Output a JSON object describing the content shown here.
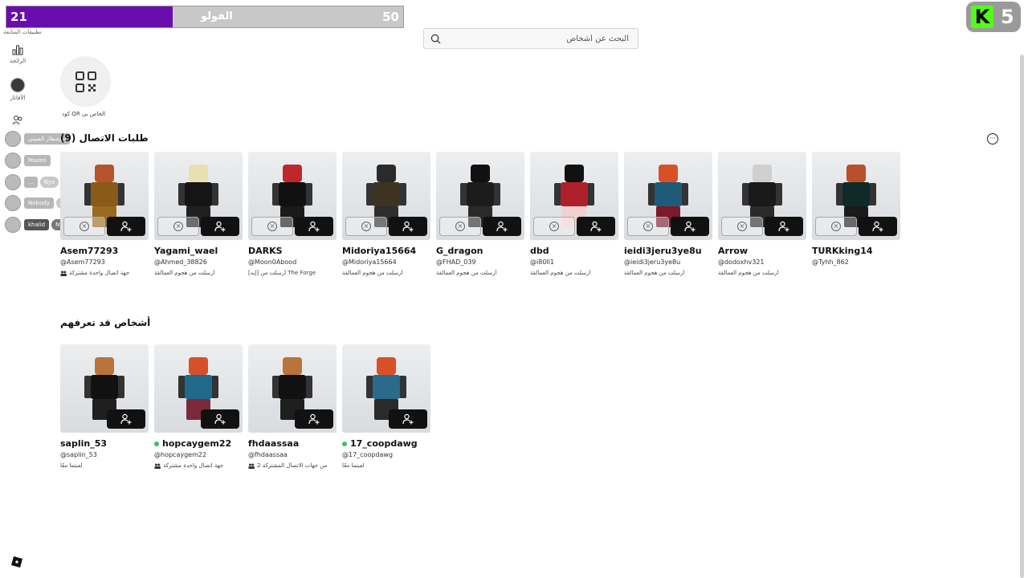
{
  "overlay": {
    "follower_count": "21",
    "follower_label": "الفولو",
    "follower_goal": "50",
    "follower_progress": 0.42,
    "kick_letter": "K",
    "kick_count": "5"
  },
  "search": {
    "placeholder": "البحث عن أشخاص"
  },
  "nav": {
    "top_label": "تطبيقات المتابعة",
    "items": [
      {
        "label": "الرائجة",
        "icon": "chart-icon"
      },
      {
        "label": "الأفاتار",
        "icon": "avatar-icon"
      }
    ],
    "streams": [
      {
        "name": "ابوشطار الصيني",
        "tag": ""
      },
      {
        "name": "Mazen",
        "tag": ""
      },
      {
        "name": "...",
        "tag": "Nyx"
      },
      {
        "name": "Nobody",
        "tag": "goth"
      },
      {
        "name": "khalid",
        "tag": "Nyx"
      }
    ]
  },
  "qr": {
    "label": "كود QR الخاص بي"
  },
  "requests": {
    "title": "طلبات الاتصال (9)",
    "cards": [
      {
        "name": "Asem77293",
        "handle": "@Asem77293",
        "meta": "جهة اتصال واحدة مشتركة",
        "icon": "people",
        "head": "#b5542a",
        "body": "#8a5a1a",
        "legs": "#9a6a20"
      },
      {
        "name": "Yagami_wael",
        "handle": "@Ahmed_38826",
        "meta": "أرسلت من هجوم العمالقة",
        "icon": "",
        "head": "#e8e0b0",
        "body": "#151515",
        "legs": "#202020"
      },
      {
        "name": "DARKS",
        "handle": "@Moon0Abood",
        "meta": "أرسلت من [إيه] The Forge",
        "icon": "",
        "head": "#c0272d",
        "body": "#111111",
        "legs": "#1a1a1a"
      },
      {
        "name": "Midoriya15664",
        "handle": "@Midoriya15664",
        "meta": "أرسلت من هجوم العمالقة",
        "icon": "",
        "head": "#2a2a2a",
        "body": "#3d3320",
        "legs": "#2e2e2e"
      },
      {
        "name": "G_dragon",
        "handle": "@FHAD_039",
        "meta": "أرسلت من هجوم العمالقة",
        "icon": "",
        "head": "#111111",
        "body": "#1c1c1c",
        "legs": "#2a2a2a"
      },
      {
        "name": "dbd",
        "handle": "@i80ll1",
        "meta": "أرسلت من هجوم العمالقة",
        "icon": "",
        "head": "#111111",
        "body": "#b0202a",
        "legs": "#f0d0d0"
      },
      {
        "name": "ieidi3jeru3ye8u",
        "handle": "@ieidi3jeru3ye8u",
        "meta": "أرسلت من هجوم العمالقة",
        "icon": "",
        "head": "#d8502a",
        "body": "#1f5a78",
        "legs": "#7a1a2a"
      },
      {
        "name": "Arrow",
        "handle": "@dodoxhv321",
        "meta": "أرسلت من هجوم العمالقة",
        "icon": "",
        "head": "#cfcfcf",
        "body": "#1a1a1a",
        "legs": "#2a2a2a"
      },
      {
        "name": "TURKking14",
        "handle": "@Tyhh_862",
        "meta": "",
        "icon": "",
        "head": "#b8502a",
        "body": "#0f2a28",
        "legs": "#1a1a1a"
      }
    ]
  },
  "suggestions": {
    "title": "أشخاص قد تعرفهم",
    "cards": [
      {
        "name": "saplin_53",
        "handle": "@saplin_53",
        "meta": "لعبتما معًا",
        "icon": "",
        "online": false,
        "head": "#b8743a",
        "body": "#111111",
        "legs": "#1f1f1f"
      },
      {
        "name": "hopcaygem22",
        "handle": "@hopcaygem22",
        "meta": "جهة اتصال واحدة مشتركة",
        "icon": "people",
        "online": true,
        "head": "#d8502a",
        "body": "#1f6a8a",
        "legs": "#7a2a3a"
      },
      {
        "name": "fhdaassaa",
        "handle": "@fhdaassaa",
        "meta": "2 من جهات الاتصال المشتركة",
        "icon": "people",
        "online": false,
        "head": "#b8743a",
        "body": "#111111",
        "legs": "#1f1f1f"
      },
      {
        "name": "17_coopdawg",
        "handle": "@17_coopdawg",
        "meta": "لعبتما معًا",
        "icon": "",
        "online": true,
        "head": "#d8502a",
        "body": "#2a6a8a",
        "legs": "#2a2a2a"
      }
    ]
  },
  "colors": {
    "accent": "#6a0dad",
    "kick": "#53fc18",
    "online": "#3fbf5a"
  }
}
